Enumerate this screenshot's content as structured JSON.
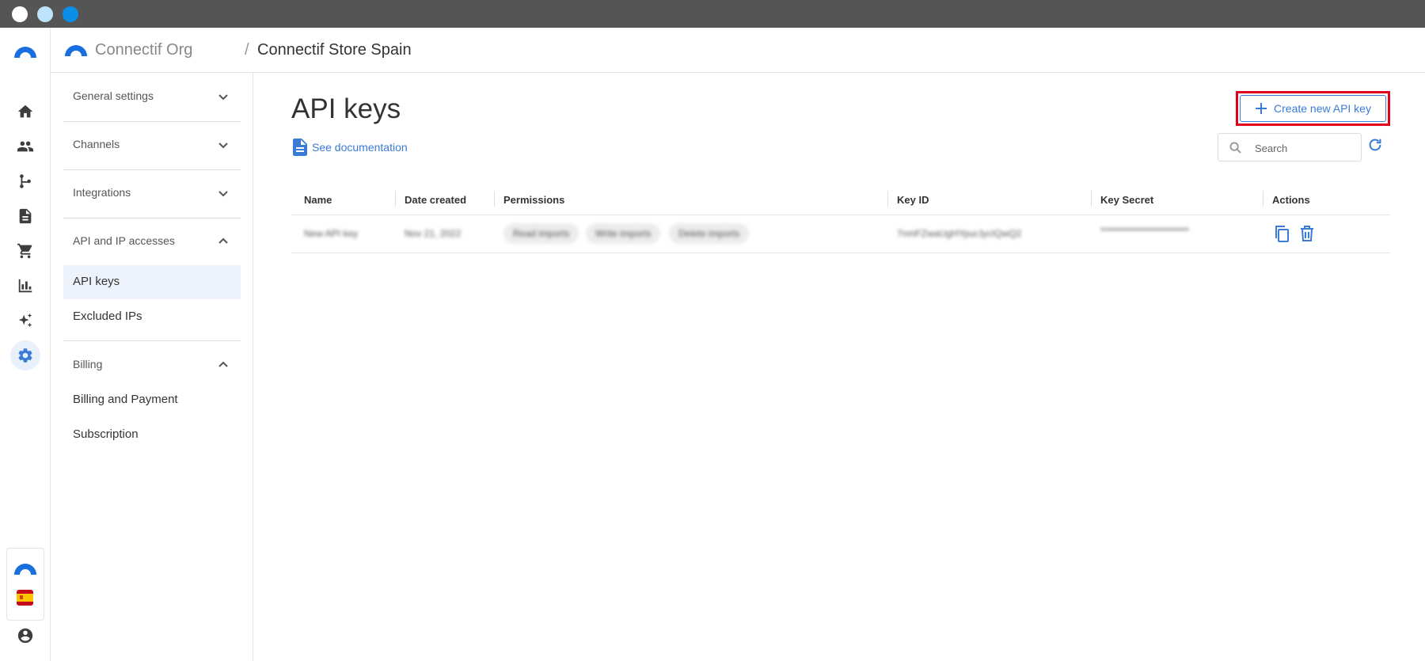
{
  "app": {
    "org_name": "Connectif Org",
    "separator": "/",
    "store_name": "Connectif Store Spain"
  },
  "rail": {
    "items": [
      "home-icon",
      "contacts-icon",
      "workflows-icon",
      "content-icon",
      "store-icon",
      "reports-icon",
      "ai-icon",
      "settings-icon"
    ],
    "active": "settings-icon",
    "bottom": [
      "connectif-logo",
      "spain-flag-icon",
      "account-icon"
    ]
  },
  "settings_nav": {
    "sections": [
      {
        "label": "General settings",
        "expanded": false
      },
      {
        "label": "Channels",
        "expanded": false
      },
      {
        "label": "Integrations",
        "expanded": false
      },
      {
        "label": "API and IP accesses",
        "expanded": true,
        "items": [
          "API keys",
          "Excluded IPs"
        ]
      },
      {
        "label": "Billing",
        "expanded": true,
        "items": [
          "Billing and Payment",
          "Subscription"
        ]
      }
    ],
    "active_item": "API keys"
  },
  "main": {
    "title": "API keys",
    "doc_link": "See documentation",
    "create_button": "Create new API key",
    "search_placeholder": "Search",
    "table": {
      "columns": [
        "Name",
        "Date created",
        "Permissions",
        "Key ID",
        "Key Secret",
        "Actions"
      ],
      "rows": [
        {
          "name": "New API key",
          "date_created": "Nov 21, 2022",
          "permissions": [
            "Read imports",
            "Write imports",
            "Delete imports"
          ],
          "key_id": "7nmFZwaUgHYpurJycIQwQ2",
          "key_secret": "••••••••••••••••••••••••••••••••"
        }
      ]
    }
  },
  "colors": {
    "accent": "#3a7bd5",
    "highlight": "#e0001b",
    "titlebar": "#555555"
  }
}
